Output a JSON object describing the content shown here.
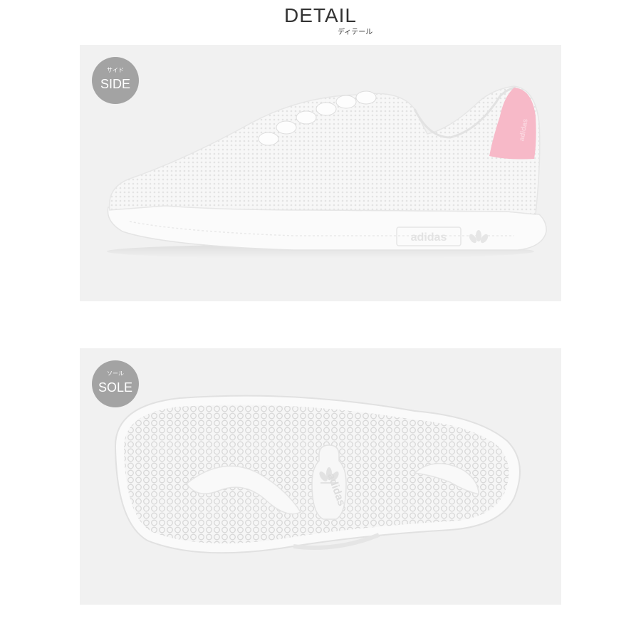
{
  "header": {
    "title": "DETAIL",
    "subtitle": "ディテール"
  },
  "panels": [
    {
      "badge_ja": "サイド",
      "badge_en": "SIDE",
      "product_brand": "adidas",
      "colors": {
        "background": "#f1f1f1",
        "badge": "#a3a3a3",
        "upper": "#f6f6f6",
        "heel_tab": "#f7b9c8"
      }
    },
    {
      "badge_ja": "ソール",
      "badge_en": "SOLE",
      "product_brand": "adidas",
      "colors": {
        "background": "#f1f1f1",
        "badge": "#a3a3a3",
        "outsole": "#fafafa",
        "tread": "#dcdcdc"
      }
    }
  ]
}
